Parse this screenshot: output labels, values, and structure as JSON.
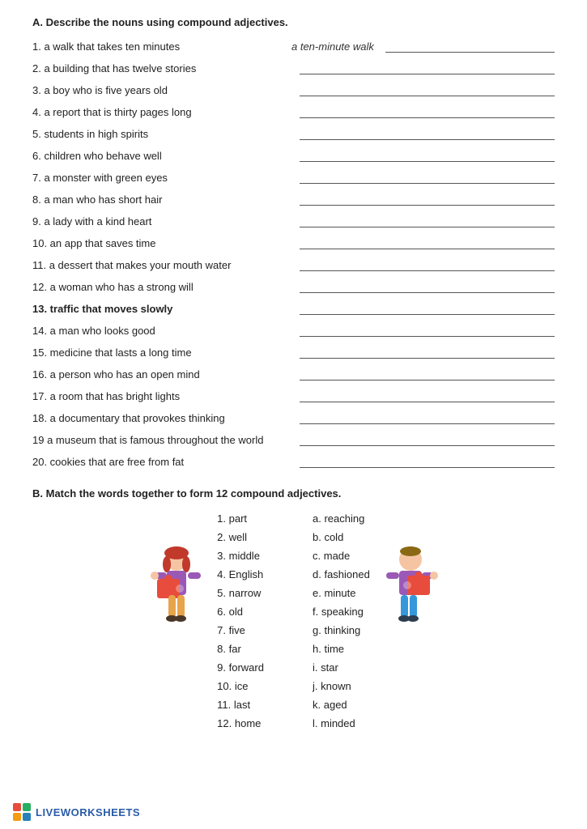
{
  "sectionA": {
    "title": "A. Describe the nouns using compound adjectives.",
    "items": [
      {
        "num": "1.",
        "text": "a walk that takes ten minutes",
        "answer": "a ten-minute walk",
        "example": true,
        "bold": false
      },
      {
        "num": "2.",
        "text": "a building that has twelve stories",
        "answer": "",
        "example": false,
        "bold": false
      },
      {
        "num": "3.",
        "text": "a boy who is five years old",
        "answer": "",
        "example": false,
        "bold": false
      },
      {
        "num": "4.",
        "text": "a report that is thirty pages long",
        "answer": "",
        "example": false,
        "bold": false
      },
      {
        "num": "5.",
        "text": "students in high spirits",
        "answer": "",
        "example": false,
        "bold": false
      },
      {
        "num": "6.",
        "text": "children who behave well",
        "answer": "",
        "example": false,
        "bold": false
      },
      {
        "num": "7.",
        "text": "a monster with green eyes",
        "answer": "",
        "example": false,
        "bold": false
      },
      {
        "num": "8.",
        "text": "a man who has short hair",
        "answer": "",
        "example": false,
        "bold": false
      },
      {
        "num": "9.",
        "text": "a lady with a kind heart",
        "answer": "",
        "example": false,
        "bold": false
      },
      {
        "num": "10.",
        "text": "an app that saves time",
        "answer": "",
        "example": false,
        "bold": false
      },
      {
        "num": "11.",
        "text": "a dessert that makes your mouth water",
        "answer": "",
        "example": false,
        "bold": false
      },
      {
        "num": "12.",
        "text": "a woman who has a strong will",
        "answer": "",
        "example": false,
        "bold": false
      },
      {
        "num": "13.",
        "text": "traffic that moves slowly",
        "answer": "",
        "example": false,
        "bold": true
      },
      {
        "num": "14.",
        "text": "a man who looks good",
        "answer": "",
        "example": false,
        "bold": false
      },
      {
        "num": "15.",
        "text": "medicine that lasts a long time",
        "answer": "",
        "example": false,
        "bold": false
      },
      {
        "num": "16.",
        "text": "a person who has an open mind",
        "answer": "",
        "example": false,
        "bold": false
      },
      {
        "num": "17.",
        "text": "a room that has bright lights",
        "answer": "",
        "example": false,
        "bold": false
      },
      {
        "num": "18.",
        "text": "a documentary that provokes thinking",
        "answer": "",
        "example": false,
        "bold": false
      },
      {
        "num": "19",
        "text": "a museum that is famous throughout the world",
        "answer": "",
        "example": false,
        "bold": false
      },
      {
        "num": "20.",
        "text": "cookies that are free from fat",
        "answer": "",
        "example": false,
        "bold": false
      }
    ]
  },
  "sectionB": {
    "title": "B. Match the words together to form 12 compound adjectives.",
    "leftCol": [
      {
        "num": "1.",
        "word": "part"
      },
      {
        "num": "2.",
        "word": "well"
      },
      {
        "num": "3.",
        "word": "middle"
      },
      {
        "num": "4.",
        "word": "English"
      },
      {
        "num": "5.",
        "word": "narrow"
      },
      {
        "num": "6.",
        "word": "old"
      },
      {
        "num": "7.",
        "word": "five"
      },
      {
        "num": "8.",
        "word": "far"
      },
      {
        "num": "9.",
        "word": "forward"
      },
      {
        "num": "10.",
        "word": "ice"
      },
      {
        "num": "11.",
        "word": "last"
      },
      {
        "num": "12.",
        "word": "home"
      }
    ],
    "rightCol": [
      {
        "letter": "a.",
        "word": "reaching"
      },
      {
        "letter": "b.",
        "word": "cold"
      },
      {
        "letter": "c.",
        "word": "made"
      },
      {
        "letter": "d.",
        "word": "fashioned"
      },
      {
        "letter": "e.",
        "word": "minute"
      },
      {
        "letter": "f.",
        "word": "speaking"
      },
      {
        "letter": "g.",
        "word": "thinking"
      },
      {
        "letter": "h.",
        "word": "time"
      },
      {
        "letter": "i.",
        "word": "star"
      },
      {
        "letter": "j.",
        "word": "known"
      },
      {
        "letter": "k.",
        "word": "aged"
      },
      {
        "letter": "l.",
        "word": "minded"
      }
    ]
  },
  "footer": {
    "logoText": "LIVEWORKSHEETS"
  }
}
